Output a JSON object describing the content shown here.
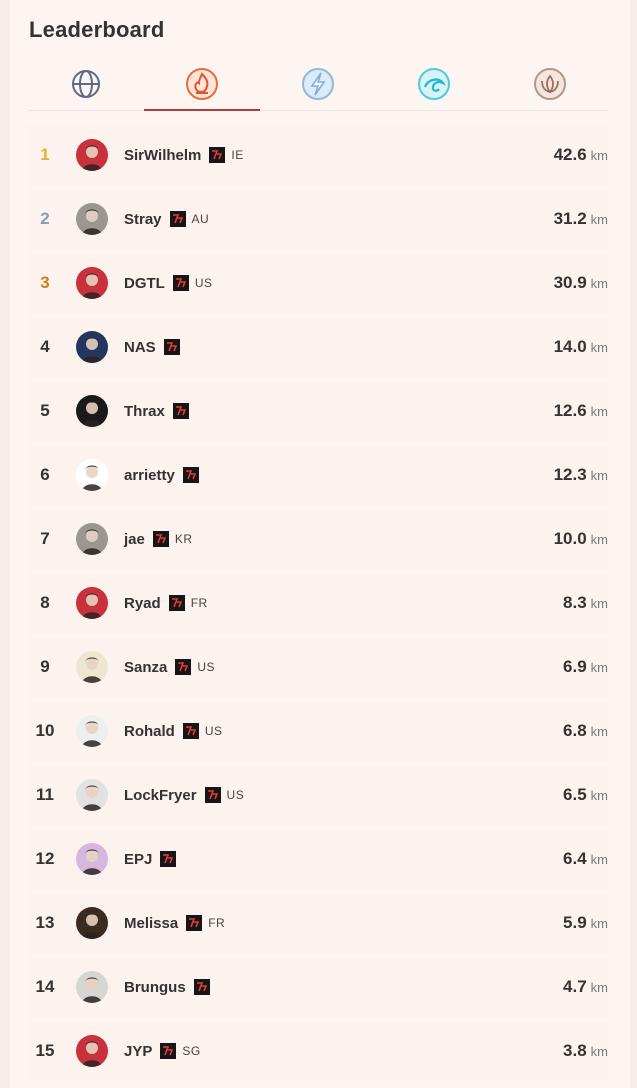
{
  "leaderboard": {
    "title": "Leaderboard",
    "tabs": [
      {
        "icon": "globe-icon",
        "active": false
      },
      {
        "icon": "fire-element-icon",
        "active": true
      },
      {
        "icon": "lightning-element-icon",
        "active": false
      },
      {
        "icon": "water-element-icon",
        "active": false
      },
      {
        "icon": "nature-element-icon",
        "active": false
      }
    ],
    "unit": "km",
    "rows": [
      {
        "rank": "1",
        "name": "SirWilhelm",
        "country": "IE",
        "distance": "42.6",
        "avatar_color": "#c8323c"
      },
      {
        "rank": "2",
        "name": "Stray",
        "country": "AU",
        "distance": "31.2",
        "avatar_color": "#9a9690"
      },
      {
        "rank": "3",
        "name": "DGTL",
        "country": "US",
        "distance": "30.9",
        "avatar_color": "#c8323c"
      },
      {
        "rank": "4",
        "name": "NAS",
        "country": "",
        "distance": "14.0",
        "avatar_color": "#23375e"
      },
      {
        "rank": "5",
        "name": "Thrax",
        "country": "",
        "distance": "12.6",
        "avatar_color": "#1a1a1a"
      },
      {
        "rank": "6",
        "name": "arrietty",
        "country": "",
        "distance": "12.3",
        "avatar_color": "#ffffff"
      },
      {
        "rank": "7",
        "name": "jae",
        "country": "KR",
        "distance": "10.0",
        "avatar_color": "#9a9690"
      },
      {
        "rank": "8",
        "name": "Ryad",
        "country": "FR",
        "distance": "8.3",
        "avatar_color": "#c8323c"
      },
      {
        "rank": "9",
        "name": "Sanza",
        "country": "US",
        "distance": "6.9",
        "avatar_color": "#efe6d2"
      },
      {
        "rank": "10",
        "name": "Rohald",
        "country": "US",
        "distance": "6.8",
        "avatar_color": "#eef0ef"
      },
      {
        "rank": "11",
        "name": "LockFryer",
        "country": "US",
        "distance": "6.5",
        "avatar_color": "#e2e2e0"
      },
      {
        "rank": "12",
        "name": "EPJ",
        "country": "",
        "distance": "6.4",
        "avatar_color": "#d7b7de"
      },
      {
        "rank": "13",
        "name": "Melissa",
        "country": "FR",
        "distance": "5.9",
        "avatar_color": "#3a2a20"
      },
      {
        "rank": "14",
        "name": "Brungus",
        "country": "",
        "distance": "4.7",
        "avatar_color": "#d6d6d2"
      },
      {
        "rank": "15",
        "name": "JYP",
        "country": "SG",
        "distance": "3.8",
        "avatar_color": "#c8323c"
      }
    ]
  }
}
